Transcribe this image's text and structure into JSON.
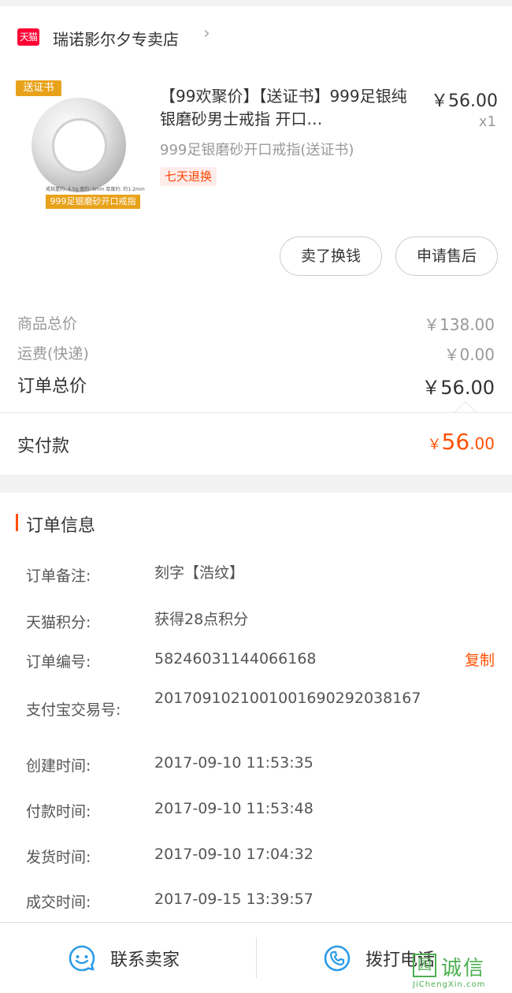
{
  "shop": {
    "badge": "天猫",
    "name": "瑞诺影尔夕专卖店",
    "chevron": "›"
  },
  "product": {
    "image_tag": "送证书",
    "image_spec": "戒指重约: 4.5g  宽约: 6mm  厚度约: 约1.2mm",
    "image_banner": "999足银磨砂开口戒指",
    "title": "【99欢聚价】【送证书】999足银纯银磨砂男士戒指 开口…",
    "variant": "999足银磨砂开口戒指(送证书)",
    "return_badge": "七天退换",
    "price": "￥56.00",
    "qty": "x1"
  },
  "actions": {
    "sell_label": "卖了换钱",
    "after_sale_label": "申请售后"
  },
  "summary": {
    "goods_total_label": "商品总价",
    "goods_total_value": "￥138.00",
    "freight_label": "运费(快递)",
    "freight_value": "￥0.00",
    "order_total_label": "订单总价",
    "order_total_value": "￥56.00",
    "paid_label": "实付款",
    "paid_yen": "￥",
    "paid_int": "56",
    "paid_dec": ".00"
  },
  "order_info": {
    "title": "订单信息",
    "copy_label": "复制",
    "rows": [
      {
        "label": "订单备注:",
        "value": "刻字【浩纹】"
      },
      {
        "label": "天猫积分:",
        "value": "获得28点积分"
      },
      {
        "label": "订单编号:",
        "value": "58246031144066168"
      },
      {
        "label": "支付宝交易号:",
        "value": "2017091021001001690292038167"
      },
      {
        "label": "创建时间:",
        "value": "2017-09-10 11:53:35"
      },
      {
        "label": "付款时间:",
        "value": "2017-09-10 11:53:48"
      },
      {
        "label": "发货时间:",
        "value": "2017-09-10 17:04:32"
      },
      {
        "label": "成交时间:",
        "value": "2017-09-15 13:39:57"
      }
    ]
  },
  "bottom_bar": {
    "contact_label": "联系卖家",
    "call_label": "拨打电话",
    "contact_icon": "chat-smile-icon",
    "call_icon": "phone-icon"
  },
  "watermark": {
    "text": "诚信",
    "box": "园",
    "url": "JiChengXin.com"
  },
  "colors": {
    "accent": "#ff5000",
    "tmall_red": "#ff0036",
    "icon_blue": "#2b9be8",
    "watermark_green": "#4caf50"
  }
}
